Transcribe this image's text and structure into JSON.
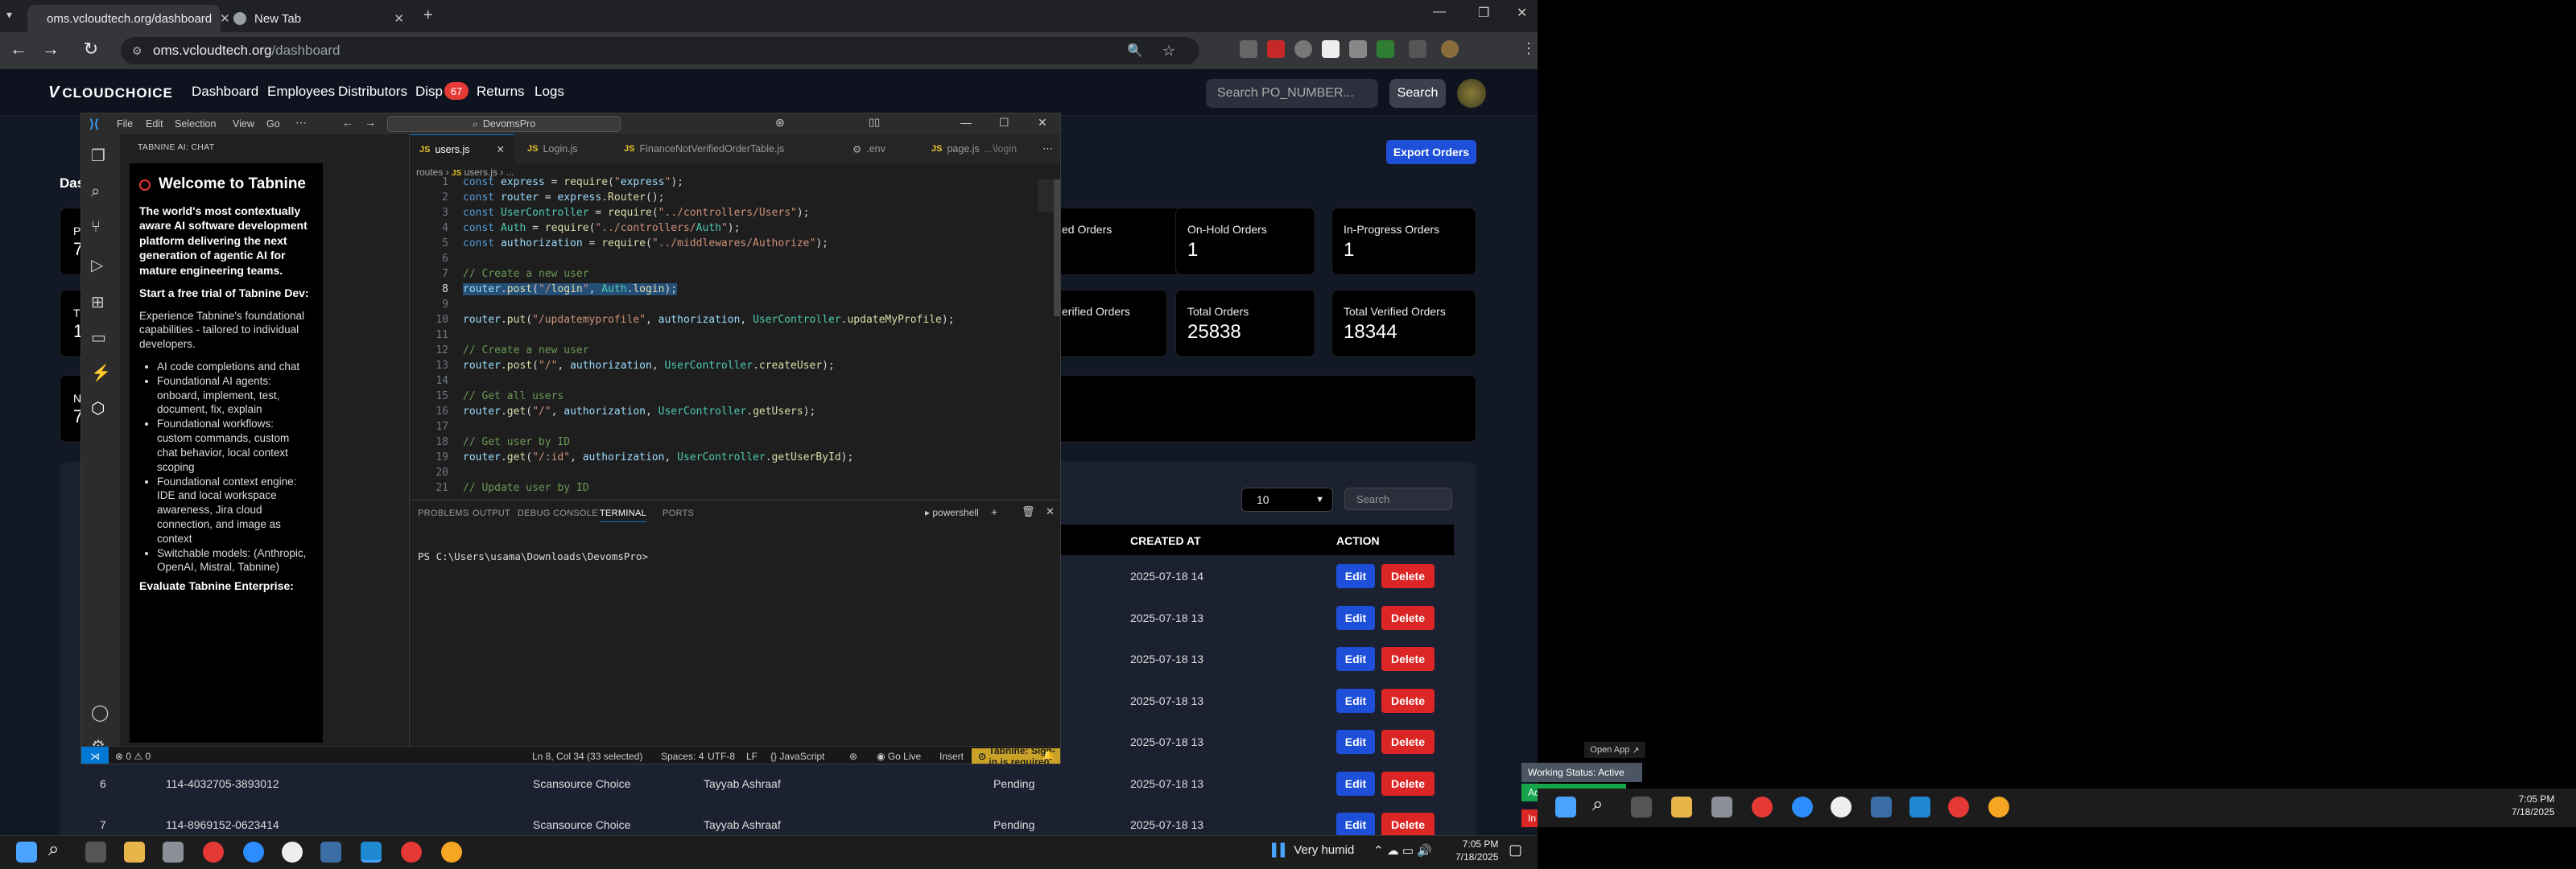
{
  "chrome": {
    "tabs": [
      {
        "title": "oms.vcloudtech.org/dashboard"
      },
      {
        "title": "New Tab"
      }
    ],
    "url_host": "oms.vcloudtech.org",
    "url_path": "/dashboard"
  },
  "site": {
    "logo": "CLOUDCHOICE",
    "nav": [
      "Dashboard",
      "Employees",
      "Distributors",
      "Disp",
      "Returns",
      "Logs"
    ],
    "nav_badge": "67",
    "search_placeholder": "Search PO_NUMBER...",
    "search_button": "Search",
    "export_button": "Export Orders",
    "left_fragments": [
      "Dash",
      "P",
      "7",
      "T",
      "1",
      "N",
      "7"
    ],
    "cards": [
      {
        "title": "ed Orders",
        "value": ""
      },
      {
        "title": "On-Hold Orders",
        "value": "1"
      },
      {
        "title": "In-Progress Orders",
        "value": "1"
      },
      {
        "title": "erified Orders",
        "value": ""
      },
      {
        "title": "Total Orders",
        "value": "25838"
      },
      {
        "title": "Total Verified Orders",
        "value": "18344"
      }
    ],
    "page_size": "10",
    "table_search_placeholder": "Search",
    "table_headers": {
      "created_at": "CREATED AT",
      "action": "ACTION"
    },
    "rows": [
      {
        "no": "",
        "po": "",
        "dist": "",
        "emp": "",
        "status": "",
        "created": "2025-07-18 14"
      },
      {
        "no": "",
        "po": "",
        "dist": "",
        "emp": "",
        "status": "",
        "created": "2025-07-18 13"
      },
      {
        "no": "",
        "po": "",
        "dist": "",
        "emp": "",
        "status": "",
        "created": "2025-07-18 13"
      },
      {
        "no": "",
        "po": "",
        "dist": "",
        "emp": "",
        "status": "",
        "created": "2025-07-18 13"
      },
      {
        "no": "",
        "po": "",
        "dist": "",
        "emp": "",
        "status": "",
        "created": "2025-07-18 13"
      },
      {
        "no": "6",
        "po": "114-4032705-3893012",
        "dist": "Scansource Choice",
        "emp": "Tayyab Ashraaf",
        "status": "Pending",
        "created": "2025-07-18 13"
      },
      {
        "no": "7",
        "po": "114-8969152-0623414",
        "dist": "Scansource Choice",
        "emp": "Tayyab Ashraaf",
        "status": "Pending",
        "created": "2025-07-18 13"
      }
    ],
    "edit_label": "Edit",
    "delete_label": "Delete"
  },
  "vscode": {
    "menu": [
      "File",
      "Edit",
      "Selection",
      "View",
      "Go"
    ],
    "command_center": "DevomsPro",
    "chat_header": "TABNINE AI: CHAT",
    "chat": {
      "welcome": "Welcome to Tabnine",
      "intro": "The world's most contextually aware AI software development platform delivering the next generation of agentic AI for mature engineering teams.",
      "trial_heading": "Start a free trial of Tabnine Dev:",
      "experience": "Experience Tabnine's foundational capabilities - tailored to individual developers.",
      "bullets": [
        "AI code completions and chat",
        "Foundational AI agents: onboard, implement, test, document, fix, explain",
        "Foundational workflows: custom commands, custom chat behavior, local context scoping",
        "Foundational context engine: IDE and local workspace awareness, Jira cloud connection, and image as context",
        "Switchable models: (Anthropic, OpenAI, Mistral, Tabnine)"
      ],
      "footer": "Evaluate Tabnine Enterprise:"
    },
    "tabs": [
      {
        "label": "users.js",
        "active": true
      },
      {
        "label": "Login.js",
        "active": false
      },
      {
        "label": "FinanceNotVerifiedOrderTable.js",
        "active": false
      },
      {
        "label": ".env",
        "active": false
      },
      {
        "label": "page.js",
        "extra": "...\\login",
        "active": false
      }
    ],
    "breadcrumb": [
      "routes",
      "users.js",
      "..."
    ],
    "code": [
      "const express = require(\"express\");",
      "const router = express.Router();",
      "const UserController = require(\"../controllers/Users\");",
      "const Auth = require(\"../controllers/Auth\");",
      "const authorization = require(\"../middlewares/Authorize\");",
      "",
      "// Create a new user",
      "router.post(\"/login\", Auth.login);",
      "",
      "router.put(\"/updatemyprofile\", authorization, UserController.updateMyProfile);",
      "",
      "// Create a new user",
      "router.post(\"/\", authorization, UserController.createUser);",
      "",
      "// Get all users",
      "router.get(\"/\", authorization, UserController.getUsers);",
      "",
      "// Get user by ID",
      "router.get(\"/:id\", authorization, UserController.getUserById);",
      "",
      "// Update user by ID"
    ],
    "panel_tabs": [
      "PROBLEMS",
      "OUTPUT",
      "DEBUG CONSOLE",
      "TERMINAL",
      "PORTS"
    ],
    "terminal_name": "powershell",
    "terminal_prompt": "PS C:\\Users\\usama\\Downloads\\DevomsPro>",
    "status": {
      "errors": "0",
      "warnings": "0",
      "position": "Ln 8, Col 34 (33 selected)",
      "spaces": "Spaces: 4",
      "encoding": "UTF-8",
      "eol": "LF",
      "language": "JavaScript",
      "golive": "Go Live",
      "insert": "Insert",
      "tabnine": "Tabnine: Sign-in is required"
    }
  },
  "taskbar": {
    "weather": "Very humid",
    "time": "7:05 PM",
    "date": "7/18/2025"
  },
  "right": {
    "open_app": "Open App",
    "working_status": "Working Status: Active",
    "badge_green": "Acti",
    "badge_red": "In A",
    "time": "7:05 PM",
    "date": "7/18/2025"
  },
  "colors": {
    "accent_blue": "#1d4fd8",
    "delete_red": "#dc2626",
    "vscode_bg": "#1e1e1e",
    "tabnine_yellow": "#c9a227"
  }
}
